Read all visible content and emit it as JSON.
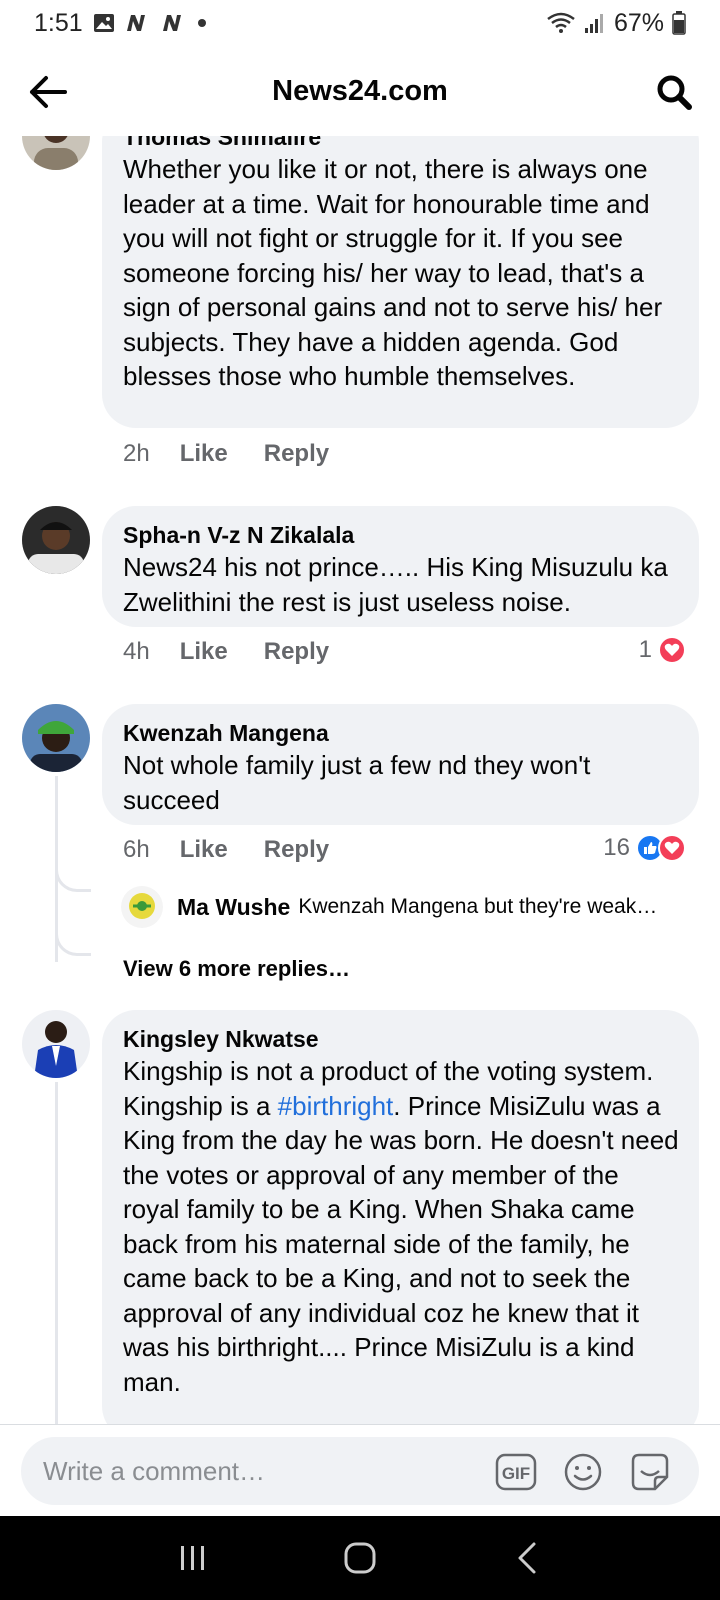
{
  "status_bar": {
    "time": "1:51",
    "battery": "67%"
  },
  "header": {
    "title": "News24.com"
  },
  "comments": [
    {
      "author": "Thomas Shimalire",
      "text": "Whether you like it or not, there is always one leader at a time. Wait for honourable time and you will not fight or struggle for it.  If you see someone forcing his/ her way to lead, that's a sign of personal gains and not to serve his/ her subjects. They have a hidden agenda. God blesses those who humble themselves.",
      "time": "2h",
      "like_label": "Like",
      "reply_label": "Reply"
    },
    {
      "author": "Spha-n V-z N Zikalala",
      "text": "News24 his not prince….. His King Misuzulu ka Zwelithini the rest is just useless noise.",
      "time": "4h",
      "like_label": "Like",
      "reply_label": "Reply",
      "reaction_count": "1"
    },
    {
      "author": "Kwenzah Mangena",
      "text": "Not whole family just a few nd they won't succeed",
      "time": "6h",
      "like_label": "Like",
      "reply_label": "Reply",
      "reaction_count": "16",
      "reply_preview": {
        "author": "Ma Wushe",
        "snippet": "Kwenzah Mangena but they're weak…"
      },
      "more_replies_label": "View 6 more replies…"
    },
    {
      "author": "Kingsley Nkwatse",
      "text_before": "Kingship is not a product of the voting system. Kingship is a ",
      "hashtag": "#birthright",
      "text_after": ". Prince MisiZulu was a King from the day he was born. He doesn't need the votes or approval of any member of the royal family to be a King. When Shaka came back from his maternal side of the family, he came back to be a King, and not to seek the approval of any individual coz he knew that it was his birthright.... Prince MisiZulu is a kind man."
    }
  ],
  "composer": {
    "placeholder": "Write a comment…",
    "gif_label": "GIF"
  },
  "colors": {
    "bubble_bg": "#f0f2f5",
    "hashtag": "#216fdb",
    "love_red": "#f33e58",
    "like_blue": "#1877f2",
    "meta_gray": "#65676b"
  }
}
